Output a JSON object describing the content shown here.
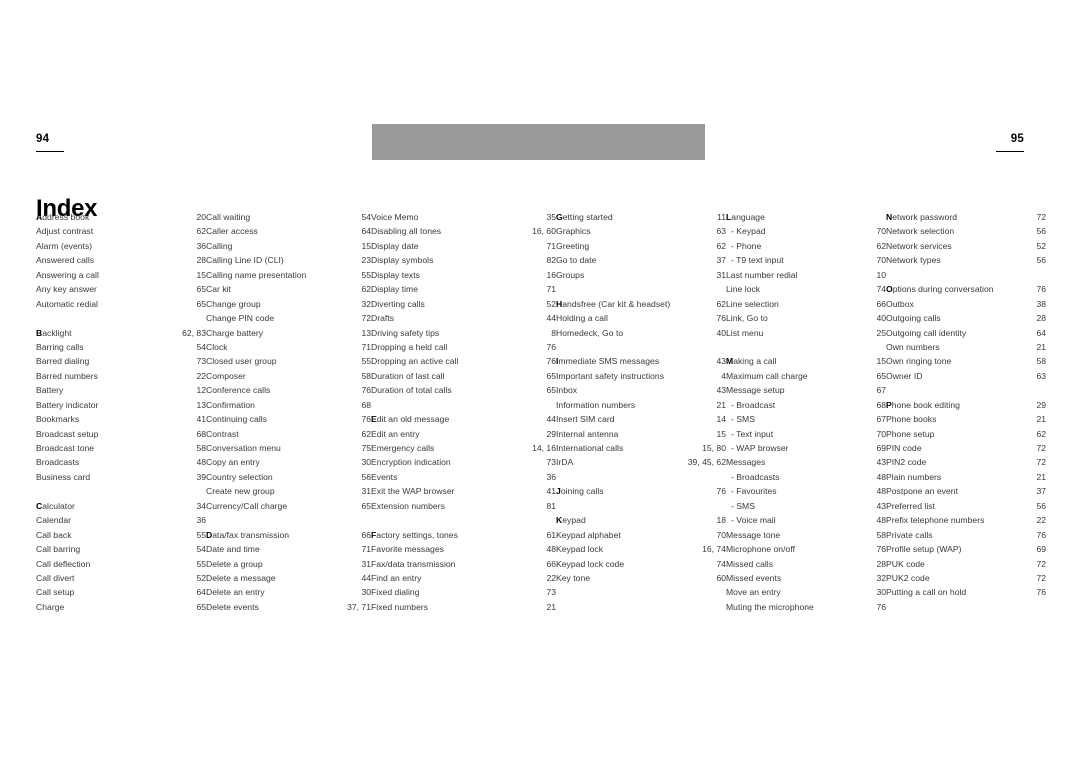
{
  "document": {
    "title": "Index",
    "folio_left": "94",
    "folio_right": "95"
  },
  "columns": [
    {
      "entries": [
        {
          "label": "Address book",
          "pages": "20",
          "bold_first": true
        },
        {
          "label": "Adjust contrast",
          "pages": "62"
        },
        {
          "label": "Alarm (events)",
          "pages": "36"
        },
        {
          "label": "Answered calls",
          "pages": "28"
        },
        {
          "label": "Answering a call",
          "pages": "15"
        },
        {
          "label": "Any key answer",
          "pages": "65"
        },
        {
          "label": "Automatic redial",
          "pages": "65"
        },
        {
          "gap": true
        },
        {
          "label": "Backlight",
          "pages": "62, 83",
          "bold_first": true
        },
        {
          "label": "Barring calls",
          "pages": "54"
        },
        {
          "label": "Barred dialing",
          "pages": "73"
        },
        {
          "label": "Barred numbers",
          "pages": "22"
        },
        {
          "label": "Battery",
          "pages": "12"
        },
        {
          "label": "Battery indicator",
          "pages": "13"
        },
        {
          "label": "Bookmarks",
          "pages": "41"
        },
        {
          "label": "Broadcast setup",
          "pages": "68"
        },
        {
          "label": "Broadcast tone",
          "pages": "58"
        },
        {
          "label": "Broadcasts",
          "pages": "48"
        },
        {
          "label": "Business card",
          "pages": "39"
        },
        {
          "gap": true
        },
        {
          "label": "Calculator",
          "pages": "34",
          "bold_first": true
        },
        {
          "label": "Calendar",
          "pages": "36"
        },
        {
          "label": "Call back",
          "pages": "55"
        },
        {
          "label": "Call barring",
          "pages": "54"
        },
        {
          "label": "Call deflection",
          "pages": "55"
        },
        {
          "label": "Call divert",
          "pages": "52"
        },
        {
          "label": "Call setup",
          "pages": "64"
        },
        {
          "label": "Charge",
          "pages": "65"
        }
      ]
    },
    {
      "entries": [
        {
          "label": "Call waiting",
          "pages": "54"
        },
        {
          "label": "Caller access",
          "pages": "64"
        },
        {
          "label": "Calling",
          "pages": "15"
        },
        {
          "label": "Calling Line ID (CLI)",
          "pages": "23"
        },
        {
          "label": "Calling name presentation",
          "pages": "55"
        },
        {
          "label": "Car kit",
          "pages": "62"
        },
        {
          "label": "Change group",
          "pages": "32"
        },
        {
          "label": "Change PIN code",
          "pages": "72"
        },
        {
          "label": "Charge battery",
          "pages": "13"
        },
        {
          "label": "Clock",
          "pages": "71"
        },
        {
          "label": "Closed user group",
          "pages": "55"
        },
        {
          "label": "Composer",
          "pages": "58"
        },
        {
          "label": "Conference calls",
          "pages": "76"
        },
        {
          "label": "Confirmation",
          "pages": "68"
        },
        {
          "label": "Continuing calls",
          "pages": "76"
        },
        {
          "label": "Contrast",
          "pages": "62"
        },
        {
          "label": "Conversation menu",
          "pages": "75"
        },
        {
          "label": "Copy an entry",
          "pages": "30"
        },
        {
          "label": "Country selection",
          "pages": "56"
        },
        {
          "label": "Create new group",
          "pages": "31"
        },
        {
          "label": "Currency/Call charge",
          "pages": "65"
        },
        {
          "gap": true
        },
        {
          "label": "Data/fax transmission",
          "pages": "66",
          "bold_first": true
        },
        {
          "label": "Date and time",
          "pages": "71"
        },
        {
          "label": "Delete a group",
          "pages": "31"
        },
        {
          "label": "Delete a message",
          "pages": "44"
        },
        {
          "label": "Delete an entry",
          "pages": "30"
        },
        {
          "label": "Delete events",
          "pages": "37, 71"
        }
      ]
    },
    {
      "entries": [
        {
          "label": "Voice Memo",
          "pages": "35"
        },
        {
          "label": "Disabling all tones",
          "pages": "16, 60"
        },
        {
          "label": "Display date",
          "pages": "71"
        },
        {
          "label": "Display symbols",
          "pages": "82"
        },
        {
          "label": "Display texts",
          "pages": "16"
        },
        {
          "label": "Display time",
          "pages": "71"
        },
        {
          "label": "Diverting calls",
          "pages": "52"
        },
        {
          "label": "Drafts",
          "pages": "44"
        },
        {
          "label": "Driving safety tips",
          "pages": "8"
        },
        {
          "label": "Dropping a held call",
          "pages": "76"
        },
        {
          "label": "Dropping an active call",
          "pages": "76"
        },
        {
          "label": "Duration of last call",
          "pages": "65"
        },
        {
          "label": "Duration of total calls",
          "pages": "65"
        },
        {
          "gap": true
        },
        {
          "label": "Edit an old message",
          "pages": "44",
          "bold_first": true
        },
        {
          "label": "Edit an entry",
          "pages": "29"
        },
        {
          "label": "Emergency calls",
          "pages": "14, 16"
        },
        {
          "label": "Encryption indication",
          "pages": "73"
        },
        {
          "label": "Events",
          "pages": "36"
        },
        {
          "label": "Exit the WAP browser",
          "pages": "41"
        },
        {
          "label": "Extension numbers",
          "pages": "81"
        },
        {
          "gap": true
        },
        {
          "label": "Factory settings, tones",
          "pages": "61",
          "bold_first": true
        },
        {
          "label": "Favorite messages",
          "pages": "48"
        },
        {
          "label": "Fax/data transmission",
          "pages": "66"
        },
        {
          "label": "Find an entry",
          "pages": "22"
        },
        {
          "label": "Fixed dialing",
          "pages": "73"
        },
        {
          "label": "Fixed numbers",
          "pages": "21"
        }
      ]
    },
    {
      "entries": [
        {
          "label": "Getting started",
          "pages": "11",
          "bold_first": true
        },
        {
          "label": "Graphics",
          "pages": "63"
        },
        {
          "label": "Greeting",
          "pages": "62"
        },
        {
          "label": "Go to date",
          "pages": "37"
        },
        {
          "label": "Groups",
          "pages": "31"
        },
        {
          "gap": true
        },
        {
          "label": "Handsfree (Car kit & headset)",
          "pages": "62",
          "bold_first": true
        },
        {
          "label": "Holding a call",
          "pages": "76"
        },
        {
          "label": "Homedeck, Go to",
          "pages": "40"
        },
        {
          "gap": true
        },
        {
          "label": "Immediate SMS messages",
          "pages": "43",
          "bold_first": true
        },
        {
          "label": "Important safety instructions",
          "pages": "4"
        },
        {
          "label": "Inbox",
          "pages": "43"
        },
        {
          "label": "Information numbers",
          "pages": "21"
        },
        {
          "label": "Insert SIM card",
          "pages": "14"
        },
        {
          "label": "Internal antenna",
          "pages": "15"
        },
        {
          "label": "International calls",
          "pages": "15, 80"
        },
        {
          "label": "IrDA",
          "pages": "39, 45, 62"
        },
        {
          "gap": true
        },
        {
          "label": "Joining calls",
          "pages": "76",
          "bold_first": true
        },
        {
          "gap": true
        },
        {
          "label": "Keypad",
          "pages": "18",
          "bold_first": true
        },
        {
          "label": "Keypad alphabet",
          "pages": "70"
        },
        {
          "label": "Keypad lock",
          "pages": "16, 74"
        },
        {
          "label": "Keypad lock code",
          "pages": "74"
        },
        {
          "label": "Key tone",
          "pages": "60"
        }
      ]
    },
    {
      "entries": [
        {
          "label": "Language",
          "pages": "",
          "bold_first": true
        },
        {
          "label": "- Keypad",
          "pages": "70",
          "sub": true
        },
        {
          "label": "- Phone",
          "pages": "62",
          "sub": true
        },
        {
          "label": "- T9 text input",
          "pages": "70",
          "sub": true
        },
        {
          "label": "Last number redial",
          "pages": "10"
        },
        {
          "label": "Line lock",
          "pages": "74"
        },
        {
          "label": "Line selection",
          "pages": "66"
        },
        {
          "label": "Link, Go to",
          "pages": "40"
        },
        {
          "label": "List menu",
          "pages": "25"
        },
        {
          "gap": true
        },
        {
          "label": "Making a call",
          "pages": "15",
          "bold_first": true
        },
        {
          "label": "Maximum call charge",
          "pages": "65"
        },
        {
          "label": "Message setup",
          "pages": "67"
        },
        {
          "label": "- Broadcast",
          "pages": "68",
          "sub": true
        },
        {
          "label": "- SMS",
          "pages": "67",
          "sub": true
        },
        {
          "label": "- Text input",
          "pages": "70",
          "sub": true
        },
        {
          "label": "- WAP browser",
          "pages": "69",
          "sub": true
        },
        {
          "label": "Messages",
          "pages": "43"
        },
        {
          "label": "- Broadcasts",
          "pages": "48",
          "sub": true
        },
        {
          "label": "- Favourites",
          "pages": "48",
          "sub": true
        },
        {
          "label": "- SMS",
          "pages": "43",
          "sub": true
        },
        {
          "label": "- Voice mail",
          "pages": "48",
          "sub": true
        },
        {
          "label": "Message tone",
          "pages": "58"
        },
        {
          "label": "Microphone on/off",
          "pages": "76"
        },
        {
          "label": "Missed calls",
          "pages": "28"
        },
        {
          "label": "Missed events",
          "pages": "32"
        },
        {
          "label": "Move an entry",
          "pages": "30"
        },
        {
          "label": "Muting the microphone",
          "pages": "76"
        }
      ]
    },
    {
      "entries": [
        {
          "label": "Network password",
          "pages": "72",
          "bold_first": true
        },
        {
          "label": "Network selection",
          "pages": "56"
        },
        {
          "label": "Network services",
          "pages": "52"
        },
        {
          "label": "Network types",
          "pages": "56"
        },
        {
          "gap": true
        },
        {
          "label": "Options during conversation",
          "pages": "76",
          "bold_first": true
        },
        {
          "label": "Outbox",
          "pages": "38"
        },
        {
          "label": "Outgoing calls",
          "pages": "28"
        },
        {
          "label": "Outgoing call identity",
          "pages": "64"
        },
        {
          "label": "Own numbers",
          "pages": "21"
        },
        {
          "label": "Own ringing tone",
          "pages": "58"
        },
        {
          "label": "Owner ID",
          "pages": "63"
        },
        {
          "gap": true
        },
        {
          "label": "Phone book editing",
          "pages": "29",
          "bold_first": true
        },
        {
          "label": "Phone books",
          "pages": "21"
        },
        {
          "label": "Phone setup",
          "pages": "62"
        },
        {
          "label": "PIN code",
          "pages": "72"
        },
        {
          "label": "PIN2 code",
          "pages": "72"
        },
        {
          "label": "Plain numbers",
          "pages": "21"
        },
        {
          "label": "Postpone an event",
          "pages": "37"
        },
        {
          "label": "Preferred list",
          "pages": "56"
        },
        {
          "label": "Prefix telephone numbers",
          "pages": "22"
        },
        {
          "label": "Private calls",
          "pages": "76"
        },
        {
          "label": "Profile setup (WAP)",
          "pages": "69"
        },
        {
          "label": "PUK code",
          "pages": "72"
        },
        {
          "label": "PUK2 code",
          "pages": "72"
        },
        {
          "label": "Putting a call on hold",
          "pages": "76"
        }
      ]
    }
  ]
}
